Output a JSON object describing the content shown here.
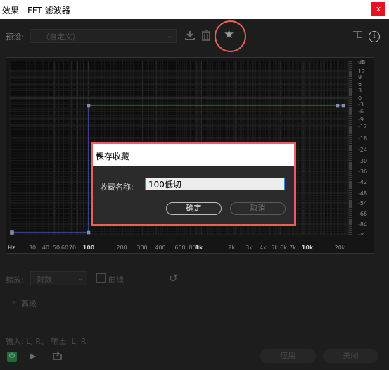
{
  "window": {
    "title": "效果 - FFT 滤波器",
    "close_glyph": "x"
  },
  "toolbar": {
    "preset_label": "预设:",
    "preset_value": "（自定义）",
    "icons": [
      "save-preset-icon",
      "delete-icon",
      "favorite-star-icon",
      "routing-icon",
      "info-icon"
    ]
  },
  "graph": {
    "db_unit": "dB",
    "db_ticks": [
      "12",
      "9",
      "6",
      "3",
      "0",
      "-3",
      "-6",
      "-9",
      "-12",
      "-18",
      "-24",
      "-30",
      "-36",
      "-42",
      "-48",
      "-54",
      "-66",
      "-84",
      "-∞"
    ],
    "freq_ticks": [
      "Hz",
      "30",
      "40",
      "50",
      "60",
      "70",
      "100",
      "200",
      "300",
      "400",
      "600",
      "800",
      "1k",
      "2k",
      "3k",
      "4k",
      "5k",
      "6k",
      "7k",
      "10k",
      "20k"
    ],
    "curve_points": [
      {
        "freq": "Hz",
        "db": "-∞"
      },
      {
        "freq": "100",
        "db": "-∞"
      },
      {
        "freq": "100",
        "db": "0"
      },
      {
        "freq": "20k",
        "db": "0"
      }
    ],
    "curve_color": "#4a58c8"
  },
  "dialog": {
    "title": "保存收藏",
    "field_label": "收藏名称:",
    "field_value": "100低切",
    "ok_label": "确定",
    "cancel_label": "取消"
  },
  "lower": {
    "scale_label": "缩放:",
    "scale_value": "对数",
    "spline_label": "曲线",
    "advanced_label": "高级"
  },
  "footer": {
    "io_text": "输入: L, R。 输出: L, R",
    "apply_label": "应用",
    "close_label": "关闭"
  },
  "colors": {
    "accent_red": "#e9605b",
    "power_green": "#1f6b3c"
  }
}
